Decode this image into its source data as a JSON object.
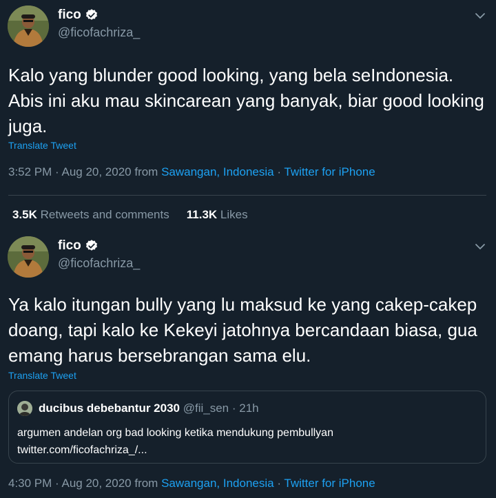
{
  "colors": {
    "background": "#15202b",
    "text": "#ffffff",
    "secondary": "#8899a6",
    "accent": "#1da1f2",
    "border": "#38444d"
  },
  "tweets": [
    {
      "name": "fico",
      "handle": "@ficofachriza_",
      "text": "Kalo yang blunder good looking, yang bela seIndonesia. Abis ini aku mau skincarean yang banyak, biar good looking juga.",
      "translate": "Translate Tweet",
      "time": "3:52 PM · Aug 20, 2020",
      "from": " from ",
      "location": "Sawangan, Indonesia",
      "sep": " · ",
      "source": "Twitter for iPhone",
      "retweets_count": "3.5K",
      "retweets_label": "Retweets and comments",
      "likes_count": "11.3K",
      "likes_label": "Likes"
    },
    {
      "name": "fico",
      "handle": "@ficofachriza_",
      "text": "Ya kalo itungan bully yang lu maksud ke yang cakep-cakep doang, tapi kalo ke Kekeyi jatohnya bercandaan biasa, gua emang harus bersebrangan sama elu.",
      "translate": "Translate Tweet",
      "quote": {
        "name": "ducibus debebantur 2030",
        "handle": "@fii_sen · 21h",
        "line1": "argumen andelan org bad looking ketika mendukung pembullyan",
        "line2": "twitter.com/ficofachriza_/..."
      },
      "time": "4:30 PM · Aug 20, 2020",
      "from": " from ",
      "location": "Sawangan, Indonesia",
      "sep": " · ",
      "source": "Twitter for iPhone"
    }
  ]
}
